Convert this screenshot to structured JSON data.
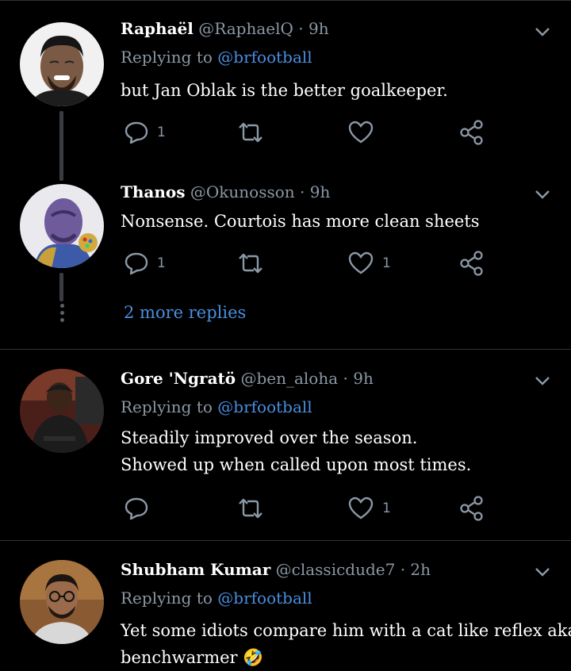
{
  "tweets": [
    {
      "name": "Raphaël",
      "handle": "@RaphaelQ",
      "time": "· 9h",
      "replying_prefix": "Replying to",
      "replying_target": "@brfootball",
      "lines": [
        "but Jan Oblak is the better goalkeeper."
      ],
      "reply_count": "1",
      "retweet_count": "",
      "like_count": ""
    },
    {
      "name": "Thanos",
      "handle": "@Okunosson",
      "time": "· 9h",
      "lines": [
        "Nonsense. Courtois has more clean sheets"
      ],
      "reply_count": "1",
      "retweet_count": "",
      "like_count": "1"
    },
    {
      "name": "Gore 'Ngratö",
      "handle": "@ben_aloha",
      "time": "· 9h",
      "replying_prefix": "Replying to",
      "replying_target": "@brfootball",
      "lines": [
        "Steadily improved over the season.",
        "Showed up when called upon most times."
      ],
      "reply_count": "",
      "retweet_count": "",
      "like_count": "1"
    },
    {
      "name": "Shubham Kumar",
      "handle": "@classicdude7",
      "time": "· 2h",
      "replying_prefix": "Replying to",
      "replying_target": "@brfootball",
      "lines": [
        "Yet some idiots compare him with a cat like reflex aka",
        "benchwarmer"
      ],
      "emoji": "🤣"
    }
  ],
  "more_replies": "2 more replies",
  "icons": {
    "reply": "reply-icon",
    "retweet": "retweet-icon",
    "like": "heart-icon",
    "share": "share-icon",
    "menu": "chevron-down-icon"
  },
  "colors": {
    "background": "#000000",
    "link": "#4a8fe0",
    "muted": "#8b98a5",
    "divider": "#2f3336"
  }
}
